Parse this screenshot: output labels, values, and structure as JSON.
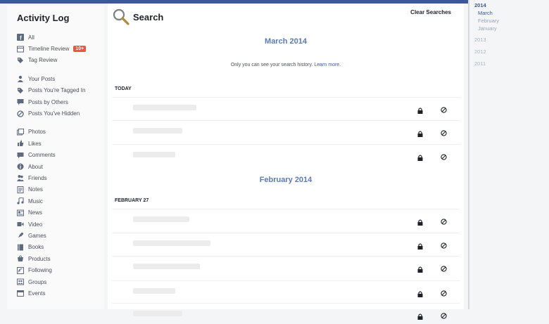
{
  "sidebar": {
    "title": "Activity Log",
    "group1": [
      {
        "icon": "facebook-icon",
        "label": "All"
      },
      {
        "icon": "timeline-icon",
        "label": "Timeline Review",
        "badge": "10+"
      },
      {
        "icon": "tag-icon",
        "label": "Tag Review"
      }
    ],
    "group2": [
      {
        "icon": "person-icon",
        "label": "Your Posts"
      },
      {
        "icon": "tag-icon",
        "label": "Posts You're Tagged In"
      },
      {
        "icon": "comment-icon",
        "label": "Posts by Others"
      },
      {
        "icon": "hidden-icon",
        "label": "Posts You've Hidden"
      }
    ],
    "group3": [
      {
        "icon": "photos-icon",
        "label": "Photos"
      },
      {
        "icon": "like-icon",
        "label": "Likes"
      },
      {
        "icon": "comment-icon",
        "label": "Comments"
      },
      {
        "icon": "about-icon",
        "label": "About"
      },
      {
        "icon": "friends-icon",
        "label": "Friends"
      },
      {
        "icon": "notes-icon",
        "label": "Notes"
      },
      {
        "icon": "music-icon",
        "label": "Music"
      },
      {
        "icon": "news-icon",
        "label": "News"
      },
      {
        "icon": "video-icon",
        "label": "Video"
      },
      {
        "icon": "games-icon",
        "label": "Games"
      },
      {
        "icon": "books-icon",
        "label": "Books"
      },
      {
        "icon": "products-icon",
        "label": "Products"
      },
      {
        "icon": "following-icon",
        "label": "Following"
      },
      {
        "icon": "groups-icon",
        "label": "Groups"
      },
      {
        "icon": "events-icon",
        "label": "Events"
      }
    ]
  },
  "main": {
    "search_title": "Search",
    "clear_label": "Clear Searches",
    "sections": [
      {
        "month": "March 2014",
        "privacy_text": "Only you can see your search history.",
        "learn_more": "Learn more.",
        "day": "TODAY"
      },
      {
        "month": "February 2014",
        "day": "FEBRUARY 27"
      }
    ]
  },
  "timeline": {
    "items": [
      {
        "label": "2014",
        "kind": "active"
      },
      {
        "label": "March",
        "kind": "sub sel"
      },
      {
        "label": "February",
        "kind": "sub"
      },
      {
        "label": "January",
        "kind": "sub"
      },
      {
        "label": "2013",
        "kind": "gap"
      },
      {
        "label": "2012",
        "kind": "gap2"
      },
      {
        "label": "2011",
        "kind": "gap2"
      }
    ]
  },
  "colors": {
    "brand": "#3b5998",
    "badge": "#e9573f",
    "month_heading": "#5b7bb5"
  }
}
